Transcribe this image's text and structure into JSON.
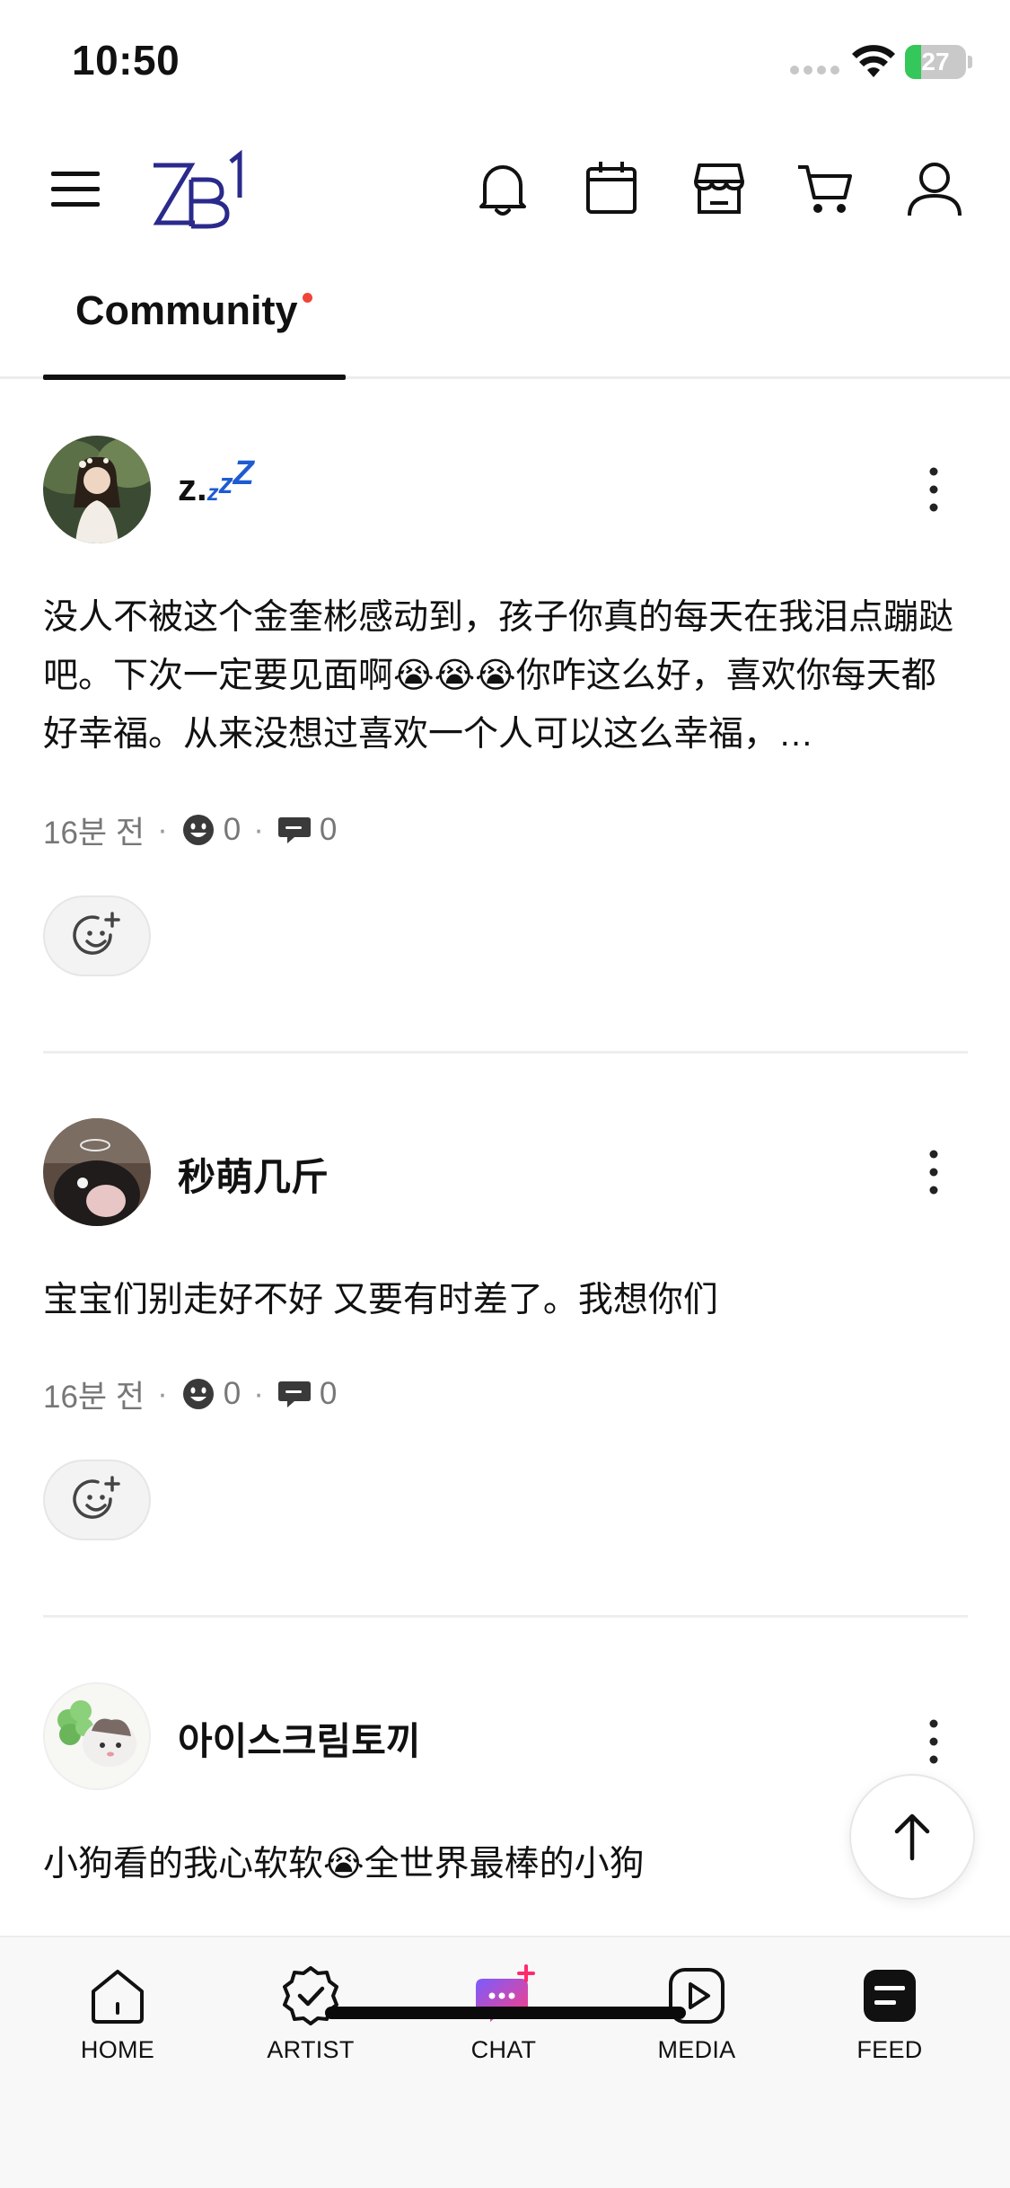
{
  "status_bar": {
    "time": "10:50",
    "battery": "27",
    "battery_level": 0.27
  },
  "header": {
    "logo_text": "ZB1"
  },
  "tabs": [
    {
      "label": "Community",
      "active": true,
      "has_new_dot": true
    }
  ],
  "posts": [
    {
      "author": "z.",
      "author_suffix": "zzZ",
      "text": "没人不被这个金奎彬感动到，孩子你真的每天在我泪点蹦跶吧。下次一定要见面啊😭😭😭你咋这么好，喜欢你每天都好幸福。从来没想过喜欢一个人可以这么幸福，…",
      "time": "16분 전",
      "reactions": "0",
      "comments": "0"
    },
    {
      "author": "秒萌几斤",
      "text": "宝宝们别走好不好 又要有时差了。我想你们",
      "time": "16분 전",
      "reactions": "0",
      "comments": "0"
    },
    {
      "author": "아이스크림토끼",
      "text": "小狗看的我心软软😭全世界最棒的小狗"
    }
  ],
  "bottom_nav": [
    {
      "label": "HOME",
      "icon": "home-icon"
    },
    {
      "label": "ARTIST",
      "icon": "artist-badge-icon"
    },
    {
      "label": "CHAT",
      "icon": "chat-icon"
    },
    {
      "label": "MEDIA",
      "icon": "media-play-icon"
    },
    {
      "label": "FEED",
      "icon": "feed-icon"
    }
  ],
  "colors": {
    "accent_red": "#f0453a",
    "logo_blue": "#2a2a8c",
    "chat_pink": "#ff3d7f",
    "chat_purple": "#7a5cff"
  }
}
